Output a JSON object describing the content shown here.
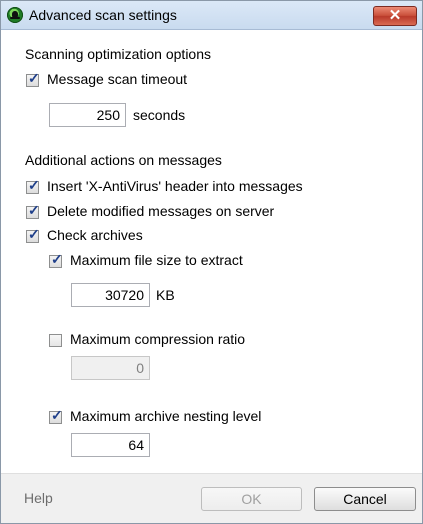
{
  "window": {
    "title": "Advanced scan settings",
    "close_label": "✕",
    "app_icon": "antivirus-bug-icon",
    "title_color": "#dbe8f7",
    "close_color": "#c94f3a"
  },
  "sections": {
    "optimization": "Scanning optimization options",
    "additional": "Additional actions on messages"
  },
  "options": {
    "message_scan_timeout": {
      "label": "Message scan timeout",
      "checked": true,
      "value": "250",
      "unit": "seconds"
    },
    "insert_header": {
      "label": "Insert 'X-AntiVirus' header into messages",
      "checked": true
    },
    "delete_modified": {
      "label": "Delete modified messages on server",
      "checked": true
    },
    "check_archives": {
      "label": "Check archives",
      "checked": true
    },
    "max_file_size": {
      "label": "Maximum file size to extract",
      "checked": true,
      "value": "30720",
      "unit": "KB"
    },
    "max_compression": {
      "label": "Maximum compression ratio",
      "checked": false,
      "value": "0",
      "disabled": true
    },
    "max_nesting": {
      "label": "Maximum archive nesting level",
      "checked": true,
      "value": "64"
    }
  },
  "footer": {
    "help": "Help",
    "ok": "OK",
    "cancel": "Cancel"
  }
}
